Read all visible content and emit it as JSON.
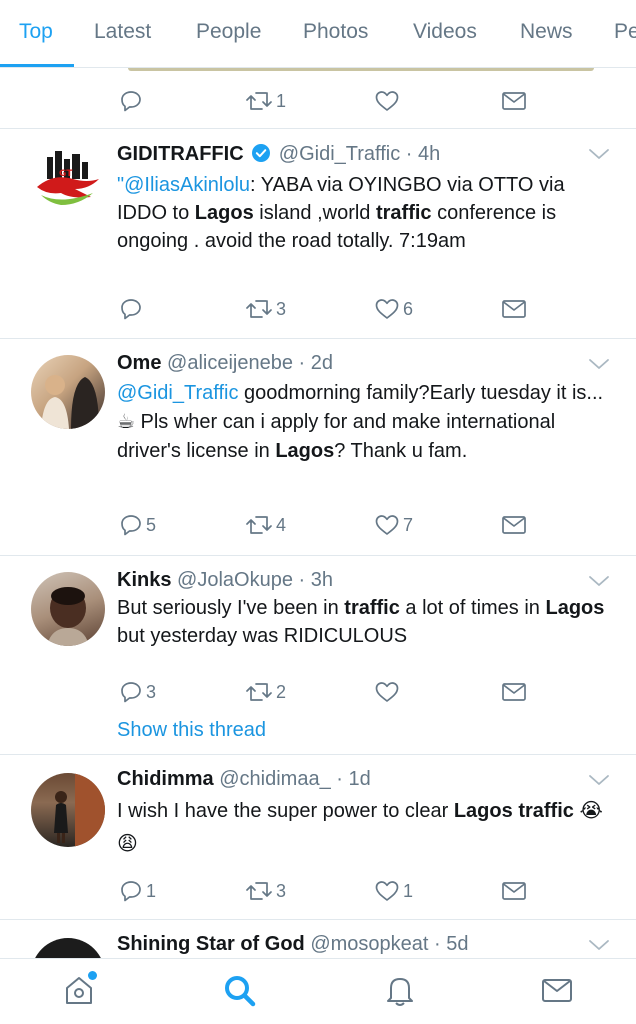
{
  "tabs": [
    {
      "label": "Top",
      "active": true
    },
    {
      "label": "Latest"
    },
    {
      "label": "People"
    },
    {
      "label": "Photos"
    },
    {
      "label": "Videos"
    },
    {
      "label": "News"
    },
    {
      "label": "Pe"
    }
  ],
  "top_partial": {
    "retweets": "1"
  },
  "tweets": [
    {
      "name": "GIDITRAFFIC",
      "verified": true,
      "handle": "@Gidi_Traffic · 4h",
      "text_parts": {
        "open_quote": "\"",
        "mention": "@IliasAkinlolu",
        "t1": ": YABA via OYINGBO via OTTO via IDDO to ",
        "b1": "Lagos",
        "t2": " island ,world ",
        "b2": "traffic",
        "t3": " conference is ongoing . avoid the road totally. 7:19am"
      },
      "replies": "",
      "retweets": "3",
      "likes": "6"
    },
    {
      "name": "Ome",
      "handle": "@aliceijenebe · 2d",
      "text_parts": {
        "mention": "@Gidi_Traffic",
        "t1": "  goodmorning family?Early tuesday it is...☕ Pls wher can i apply for and make international driver's license in ",
        "b1": "Lagos",
        "t2": "? Thank u fam."
      },
      "replies": "5",
      "retweets": "4",
      "likes": "7"
    },
    {
      "name": "Kinks",
      "handle": "@JolaOkupe · 3h",
      "text_parts": {
        "t1": "But seriously I've been in ",
        "b1": "traffic",
        "t2": " a lot of times in ",
        "b2": "Lagos",
        "t3": " but yesterday was RIDICULOUS"
      },
      "replies": "3",
      "retweets": "2",
      "likes": "",
      "show_thread": "Show this thread"
    },
    {
      "name": "Chidimma",
      "handle": "@chidimaa_ · 1d",
      "text_parts": {
        "t1": "I wish I have the super power to clear ",
        "b1": "Lagos",
        "t2": " ",
        "b2": "traffic",
        "emoji": " 😭😩"
      },
      "replies": "1",
      "retweets": "3",
      "likes": "1"
    },
    {
      "name": "Shining Star of God",
      "handle": "@mosopkeat · 5d"
    }
  ],
  "colors": {
    "accent": "#1da1f2",
    "link": "#1b95e0",
    "muted": "#657786",
    "divider": "#e1e8ed"
  },
  "icons": [
    "reply-icon",
    "retweet-icon",
    "like-icon",
    "dm-icon",
    "chevron-down-icon",
    "verified-badge-icon",
    "home-icon",
    "search-icon",
    "notifications-icon",
    "messages-icon"
  ]
}
